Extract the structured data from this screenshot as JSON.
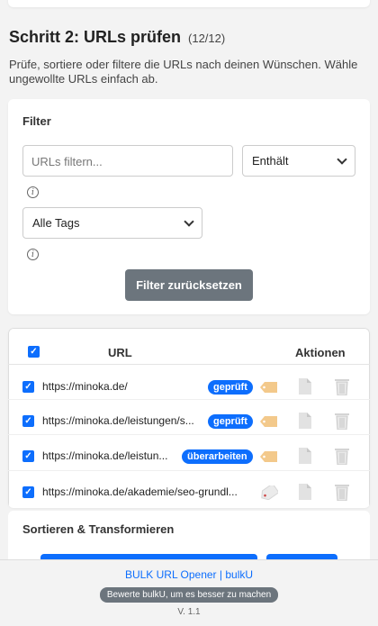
{
  "step": {
    "title": "Schritt 2: URLs prüfen",
    "count": "(12/12)",
    "description": "Prüfe, sortiere oder filtere die URLs nach deinen Wünschen. Wähle ungewollte URLs einfach ab."
  },
  "filter": {
    "label": "Filter",
    "url_placeholder": "URLs filtern...",
    "match_mode": "Enthält",
    "tags_value": "Alle Tags",
    "info_glyph": "i",
    "reset_label": "Filter zurücksetzen"
  },
  "table": {
    "columns": {
      "url": "URL",
      "actions": "Aktionen"
    },
    "check_glyph": "✓",
    "rows": [
      {
        "url": "https://minoka.de/",
        "checked": true,
        "badge": "geprüft",
        "tag_icon": "tag-icon"
      },
      {
        "url": "https://minoka.de/leistungen/s...",
        "checked": true,
        "badge": "geprüft",
        "tag_icon": "tag-icon"
      },
      {
        "url": "https://minoka.de/leistun...",
        "checked": true,
        "badge": "überarbeiten",
        "tag_icon": "tag-icon"
      },
      {
        "url": "https://minoka.de/akademie/seo-grundl...",
        "checked": true,
        "badge": "",
        "tag_icon": "tag-grey-icon"
      }
    ]
  },
  "sort": {
    "label": "Sortieren & Transformieren"
  },
  "footer": {
    "link": "BULK URL Opener | bulkU",
    "rate_label": "Bewerte bulkU, um es besser zu machen",
    "version": "V. 1.1"
  },
  "colors": {
    "primary": "#0d6efd",
    "secondary": "#6c757d",
    "background": "#f3f3f3",
    "tag": "#f3c98b"
  }
}
